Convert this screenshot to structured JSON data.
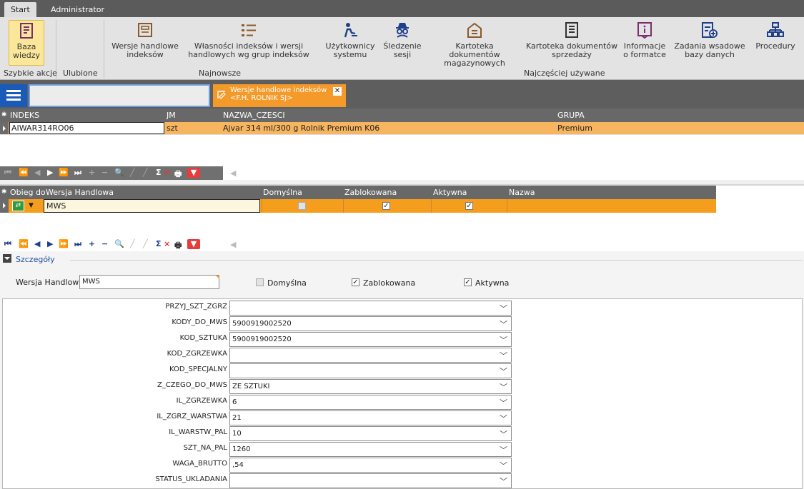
{
  "tabs": [
    "Start",
    "Administrator"
  ],
  "ribbon": {
    "buttons": [
      {
        "label": "Baza\nwiedzy",
        "icon": "knowledge-base-icon"
      },
      {
        "label": "Wersje handlowe\nindeksów",
        "icon": "trade-versions-icon"
      },
      {
        "label": "Własności indeksów i wersji\nhandlowych wg grup indeksów",
        "icon": "properties-list-icon"
      },
      {
        "label": "Użytkownicy\nsystemu",
        "icon": "users-icon"
      },
      {
        "label": "Śledzenie\nsesji",
        "icon": "spy-icon"
      },
      {
        "label": "Kartoteka dokumentów\nmagazynowych",
        "icon": "warehouse-docs-icon"
      },
      {
        "label": "Kartoteka dokumentów\nsprzedaży",
        "icon": "sales-docs-icon"
      },
      {
        "label": "Informacje\no formatce",
        "icon": "info-icon"
      },
      {
        "label": "Zadania wsadowe\nbazy danych",
        "icon": "batch-jobs-icon"
      },
      {
        "label": "Procedury",
        "icon": "procedures-icon"
      }
    ],
    "groups": [
      "Szybkie akcje",
      "Ulubione",
      "Najnowsze",
      "Najczęściej używane"
    ]
  },
  "doc_tab": {
    "line1": "Wersje handlowe indeksów",
    "line2": "<F.H. ROLNIK SJ>"
  },
  "grid_indeks": {
    "columns": [
      "INDEKS",
      "JM",
      "NAZWA_CZESCI",
      "GRUPA"
    ],
    "row": {
      "indeks": "AIWAR314RO06",
      "jm": "szt",
      "nazwa": "Ajvar 314 ml/300 g Rolnik Premium K06",
      "grupa": "Premium"
    }
  },
  "grid_wersje": {
    "columns": [
      "Obieg do",
      "Wersja Handlowa",
      "Domyślna",
      "Zablokowana",
      "Aktywna",
      "Nazwa"
    ],
    "row": {
      "wersja": "MWS",
      "domyslna": false,
      "zablokowana": true,
      "aktywna": true
    }
  },
  "details": {
    "title": "Szczegóły",
    "wersja_label": "Wersja Handlowa",
    "wersja_value": "MWS",
    "domyslna_label": "Domyślna",
    "zablokowana_label": "Zablokowana",
    "aktywna_label": "Aktywna",
    "attributes": [
      {
        "name": "PRZYJ_SZT_ZGRZ",
        "value": ""
      },
      {
        "name": "KODY_DO_MWS",
        "value": "5900919002520"
      },
      {
        "name": "KOD_SZTUKA",
        "value": "5900919002520"
      },
      {
        "name": "KOD_ZGRZEWKA",
        "value": ""
      },
      {
        "name": "KOD_SPECJALNY",
        "value": ""
      },
      {
        "name": "Z_CZEGO_DO_MWS",
        "value": "ZE SZTUKI"
      },
      {
        "name": "IL_ZGRZEWKA",
        "value": "6"
      },
      {
        "name": "IL_ZGRZ_WARSTWA",
        "value": "21"
      },
      {
        "name": "IL_WARSTW_PAL",
        "value": "10"
      },
      {
        "name": "SZT_NA_PAL",
        "value": "1260"
      },
      {
        "name": "WAGA_BRUTTO",
        "value": ",54"
      },
      {
        "name": "STATUS_UKLADANIA",
        "value": ""
      }
    ]
  },
  "colors": {
    "accent_orange": "#f7b560",
    "tab_orange": "#f39a2a",
    "blue": "#1a5ab8",
    "purple": "#7a2e6e",
    "dark_blue": "#1f3f8a",
    "brown": "#8a5a2a"
  }
}
